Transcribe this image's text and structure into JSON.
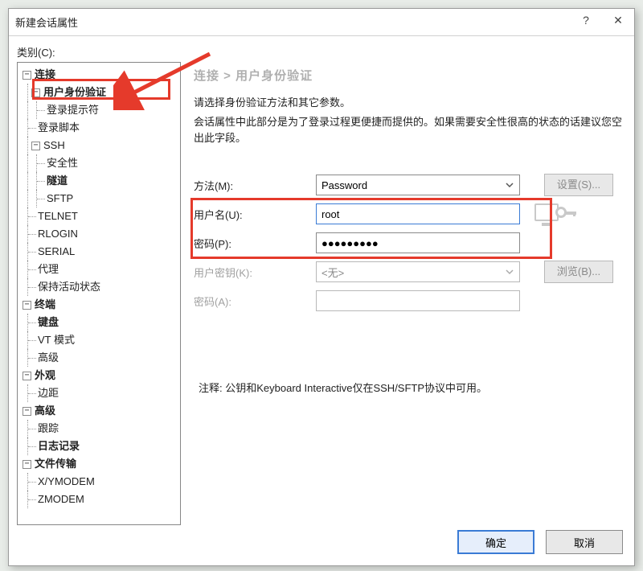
{
  "window": {
    "title": "新建会话属性"
  },
  "category_label": "类别(C):",
  "tree": {
    "connection": "连接",
    "user_auth": "用户身份验证",
    "login_prompt": "登录提示符",
    "login_script": "登录脚本",
    "ssh": "SSH",
    "security": "安全性",
    "tunnel": "隧道",
    "sftp": "SFTP",
    "telnet": "TELNET",
    "rlogin": "RLOGIN",
    "serial": "SERIAL",
    "proxy": "代理",
    "keep_alive": "保持活动状态",
    "terminal": "终端",
    "keyboard": "键盘",
    "vt_mode": "VT 模式",
    "advanced_term": "高级",
    "appearance": "外观",
    "margin": "边距",
    "advanced": "高级",
    "trace": "跟踪",
    "logging": "日志记录",
    "file_transfer": "文件传输",
    "xymodem": "X/YMODEM",
    "zmodem": "ZMODEM"
  },
  "breadcrumb": "连接 > 用户身份验证",
  "desc": {
    "line1": "请选择身份验证方法和其它参数。",
    "line2": "会话属性中此部分是为了登录过程更便捷而提供的。如果需要安全性很高的状态的话建议您空出此字段。"
  },
  "form": {
    "method_label": "方法(M):",
    "method_value": "Password",
    "settings_btn": "设置(S)...",
    "username_label": "用户名(U):",
    "username_value": "root",
    "password_label": "密码(P):",
    "password_value": "●●●●●●●●●",
    "userkey_label": "用户密钥(K):",
    "userkey_value": "<无>",
    "browse_btn": "浏览(B)...",
    "password2_label": "密码(A):"
  },
  "note": "注释: 公钥和Keyboard Interactive仅在SSH/SFTP协议中可用。",
  "buttons": {
    "ok": "确定",
    "cancel": "取消"
  }
}
